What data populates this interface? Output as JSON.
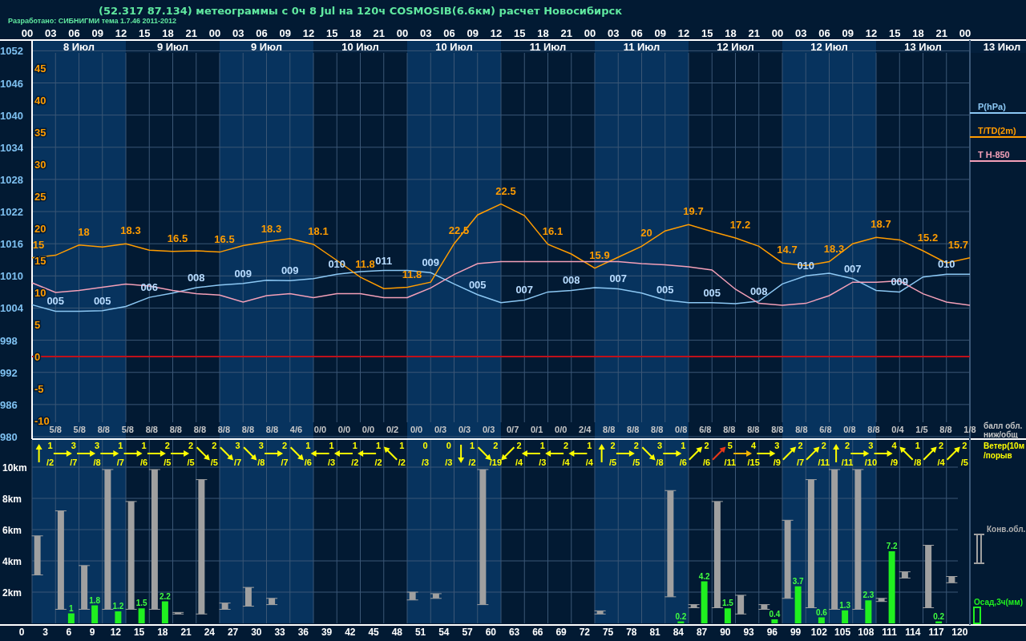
{
  "header": {
    "title": "(52.317 87.134) метеограммы с  0ч 8 Jul на 120ч COSMOSIB(6.6км) расчет Новосибирск",
    "credit": "Разработано: СИБНИГМИ тема 1.7.46 2011-2012"
  },
  "days": [
    {
      "label": "8 Июл",
      "shaded": true
    },
    {
      "label": "9 Июл",
      "shaded": false
    },
    {
      "label": "9 Июл",
      "shaded": true
    },
    {
      "label": "10 Июл",
      "shaded": false
    },
    {
      "label": "10 Июл",
      "shaded": true
    },
    {
      "label": "11 Июл",
      "shaded": false
    },
    {
      "label": "11 Июл",
      "shaded": true
    },
    {
      "label": "12 Июл",
      "shaded": false
    },
    {
      "label": "12 Июл",
      "shaded": true
    },
    {
      "label": "13 Июл",
      "shaded": false
    },
    {
      "label": "13 Июл",
      "shaded": false
    }
  ],
  "pressure_chart": {
    "chart_data": {
      "type": "line",
      "ylim": [
        980,
        1054
      ],
      "yticks": [
        1052,
        1046,
        1040,
        1034,
        1028,
        1022,
        1016,
        1010,
        1004,
        998,
        992,
        986,
        980
      ],
      "series": [
        {
          "name": "P(hPa)",
          "color": "#8cc8f4",
          "values": [
            1004.6,
            1003.4,
            1003.4,
            1003.5,
            1004.3,
            1006,
            1006.8,
            1007.8,
            1008.3,
            1008.6,
            1009.2,
            1009.1,
            1009.5,
            1010.3,
            1010.8,
            1011,
            1011,
            1010.6,
            1008.5,
            1006.5,
            1005,
            1005.5,
            1007,
            1007.3,
            1007.8,
            1007.6,
            1006.8,
            1005.5,
            1005,
            1005,
            1004.8,
            1005.3,
            1008.5,
            1010,
            1010.5,
            1009.5,
            1007.3,
            1007,
            1009.8,
            1010.3,
            1010.3
          ]
        }
      ]
    }
  },
  "temperature_chart": {
    "chart_data": {
      "type": "line",
      "categories": [
        "00",
        "03",
        "06",
        "09",
        "12",
        "15",
        "18",
        "21",
        "00",
        "03",
        "06",
        "09",
        "12",
        "15",
        "18",
        "21",
        "00",
        "03",
        "06",
        "09",
        "12",
        "15",
        "18",
        "21",
        "00",
        "03",
        "06",
        "09",
        "12",
        "15",
        "18",
        "21",
        "00",
        "03",
        "06",
        "09",
        "12",
        "15",
        "18",
        "21",
        "00"
      ],
      "ylim": [
        -10,
        45
      ],
      "yticks": [
        45,
        40,
        35,
        30,
        25,
        20,
        15,
        10,
        5,
        0,
        -5,
        -10
      ],
      "ref_lines": [
        {
          "axis": "y",
          "value": 0,
          "color": "#c0101a"
        }
      ],
      "series": [
        {
          "name": "T/TD(2m)",
          "color": "#ff9c00",
          "values": [
            15.4,
            15.8,
            17.4,
            17.1,
            17.6,
            16.6,
            16.4,
            16.5,
            16.3,
            17.3,
            17.9,
            18.4,
            17.5,
            15,
            12.4,
            10.6,
            10.8,
            11.6,
            17.6,
            22.1,
            23.8,
            22,
            17.5,
            16,
            13.8,
            15.5,
            17.2,
            19.6,
            20.6,
            19.5,
            18.5,
            17.2,
            14.6,
            14.2,
            14.8,
            17.6,
            18.6,
            18.2,
            16.5,
            14.6,
            15.4
          ]
        },
        {
          "name": "T H-850",
          "color": "#f4a0b8",
          "values": [
            11.5,
            10,
            10.3,
            10.8,
            11.3,
            11,
            10.3,
            9.8,
            9.6,
            8.5,
            9.5,
            9.8,
            9.2,
            9.8,
            9.8,
            9.2,
            9.2,
            10.7,
            12.8,
            14.5,
            14.8,
            14.8,
            14.8,
            14.8,
            14.8,
            14.8,
            14.5,
            14.3,
            14,
            13.5,
            10.5,
            8.3,
            8,
            8.3,
            9.5,
            11.6,
            11.6,
            11.8,
            9.8,
            8.5,
            8
          ]
        }
      ]
    }
  },
  "pressure_labels": [
    "005",
    "005",
    "006",
    "008",
    "009",
    "009",
    "010",
    "011",
    "009",
    "005",
    "007",
    "008",
    "007",
    "005",
    "005",
    "008",
    "010",
    "007",
    "009",
    "010"
  ],
  "temperature_labels": [
    "15",
    "18",
    "18.3",
    "16.5",
    "16.5",
    "18.3",
    "18.1",
    "11.8",
    "11.8",
    "22.5",
    "22.5",
    "16.1",
    "15.9",
    "20",
    "19.7",
    "17.2",
    "14.7",
    "18.3",
    "18.7",
    "15.2",
    "15.7"
  ],
  "cloud_cover": {
    "title": [
      "балл обл.",
      "ниж/общ"
    ],
    "values": [
      "5/8",
      "5/8",
      "8/8",
      "5/8",
      "8/8",
      "8/8",
      "8/8",
      "8/8",
      "8/8",
      "8/8",
      "4/6",
      "0/0",
      "0/0",
      "0/0",
      "0/2",
      "0/0",
      "0/3",
      "0/3",
      "0/3",
      "0/7",
      "0/1",
      "0/0",
      "2/4",
      "8/8",
      "8/8",
      "8/8",
      "0/8",
      "6/8",
      "8/8",
      "8/8",
      "8/8",
      "8/8",
      "6/8",
      "0/8",
      "8/8",
      "0/4",
      "1/5",
      "8/8",
      "1/8"
    ]
  },
  "wind": {
    "title": [
      "Ветер(10м",
      "/порыв"
    ],
    "items": [
      {
        "speed": "1",
        "gust": "/2",
        "kind": "north",
        "color": "#ffff00"
      },
      {
        "speed": "3",
        "gust": "/7",
        "kind": "east",
        "color": "#ffff00"
      },
      {
        "speed": "3",
        "gust": "/8",
        "kind": "east",
        "color": "#ffff00"
      },
      {
        "speed": "1",
        "gust": "/7",
        "kind": "east",
        "color": "#ffff00"
      },
      {
        "speed": "1",
        "gust": "/6",
        "kind": "east",
        "color": "#ffff00"
      },
      {
        "speed": "2",
        "gust": "/5",
        "kind": "east",
        "color": "#ffff00"
      },
      {
        "speed": "2",
        "gust": "/5",
        "kind": "east",
        "color": "#ffff00"
      },
      {
        "speed": "2",
        "gust": "/5",
        "kind": "southeast",
        "color": "#ffff00"
      },
      {
        "speed": "3",
        "gust": "/7",
        "kind": "southeast",
        "color": "#ffff00"
      },
      {
        "speed": "3",
        "gust": "/8",
        "kind": "southeast",
        "color": "#ffff00"
      },
      {
        "speed": "2",
        "gust": "/7",
        "kind": "east",
        "color": "#ffff00"
      },
      {
        "speed": "1",
        "gust": "/6",
        "kind": "southeast",
        "color": "#ffff00"
      },
      {
        "speed": "1",
        "gust": "/3",
        "kind": "west",
        "color": "#ffff00"
      },
      {
        "speed": "1",
        "gust": "/2",
        "kind": "west",
        "color": "#ffff00"
      },
      {
        "speed": "1",
        "gust": "/2",
        "kind": "west",
        "color": "#ffff00"
      },
      {
        "speed": "1",
        "gust": "/2",
        "kind": "northwest",
        "color": "#ffff00"
      },
      {
        "speed": "0",
        "gust": "/3",
        "kind": "calm"
      },
      {
        "speed": "0",
        "gust": "/3",
        "kind": "calm"
      },
      {
        "speed": "1",
        "gust": "/2",
        "kind": "south",
        "color": "#ffff00"
      },
      {
        "speed": "2",
        "gust": "/19",
        "kind": "southeast",
        "color": "#ffff00"
      },
      {
        "speed": "2",
        "gust": "/4",
        "kind": "southwest",
        "color": "#ffff00"
      },
      {
        "speed": "1",
        "gust": "/3",
        "kind": "west",
        "color": "#ffff00"
      },
      {
        "speed": "2",
        "gust": "/4",
        "kind": "west",
        "color": "#ffff00"
      },
      {
        "speed": "1",
        "gust": "/4",
        "kind": "west",
        "color": "#ffff00"
      },
      {
        "speed": "2",
        "gust": "/5",
        "kind": "north",
        "color": "#ffff00"
      },
      {
        "speed": "2",
        "gust": "/5",
        "kind": "east",
        "color": "#ffff00"
      },
      {
        "speed": "3",
        "gust": "/8",
        "kind": "southeast",
        "color": "#ffff00"
      },
      {
        "speed": "1",
        "gust": "/6",
        "kind": "east",
        "color": "#ffff00"
      },
      {
        "speed": "2",
        "gust": "/6",
        "kind": "northeast",
        "color": "#ffff00"
      },
      {
        "speed": "5",
        "gust": "/11",
        "kind": "northeast",
        "color": "#e83818"
      },
      {
        "speed": "4",
        "gust": "/15",
        "kind": "east",
        "color": "#f4b400"
      },
      {
        "speed": "3",
        "gust": "/9",
        "kind": "east",
        "color": "#ffff00"
      },
      {
        "speed": "2",
        "gust": "/7",
        "kind": "northeast",
        "color": "#ffff00"
      },
      {
        "speed": "2",
        "gust": "/11",
        "kind": "northeast",
        "color": "#ffff00"
      },
      {
        "speed": "2",
        "gust": "/11",
        "kind": "north",
        "color": "#ffff00"
      },
      {
        "speed": "3",
        "gust": "/10",
        "kind": "east",
        "color": "#ffff00"
      },
      {
        "speed": "4",
        "gust": "/9",
        "kind": "east",
        "color": "#ffff00"
      },
      {
        "speed": "1",
        "gust": "/8",
        "kind": "northwest",
        "color": "#ffff00"
      },
      {
        "speed": "2",
        "gust": "/4",
        "kind": "northeast",
        "color": "#ffff00"
      },
      {
        "speed": "2",
        "gust": "/5",
        "kind": "northeast",
        "color": "#ffff00"
      }
    ]
  },
  "lower": {
    "height_axis": [
      "10km",
      "8km",
      "6km",
      "4km",
      "2km"
    ],
    "origin_label": "0",
    "legend": [
      {
        "label": "Конв.обл.",
        "color": "#a0a0a0"
      },
      {
        "label": "Осад,3ч(мм)",
        "color": "#20f020"
      }
    ],
    "slots": [
      {
        "hour": "3"
      },
      {
        "hour": "6",
        "precip": "1"
      },
      {
        "hour": "9",
        "precip": "1.8"
      },
      {
        "hour": "12",
        "precip": "1.2"
      },
      {
        "hour": "15",
        "precip": "1.5"
      },
      {
        "hour": "18",
        "precip": "2.2"
      },
      {
        "hour": "21"
      },
      {
        "hour": "24"
      },
      {
        "hour": "27"
      },
      {
        "hour": "30"
      },
      {
        "hour": "33"
      },
      {
        "hour": "36"
      },
      {
        "hour": "39"
      },
      {
        "hour": "42"
      },
      {
        "hour": "45"
      },
      {
        "hour": "48"
      },
      {
        "hour": "51"
      },
      {
        "hour": "54"
      },
      {
        "hour": "57"
      },
      {
        "hour": "60"
      },
      {
        "hour": "63"
      },
      {
        "hour": "66"
      },
      {
        "hour": "69"
      },
      {
        "hour": "72"
      },
      {
        "hour": "75"
      },
      {
        "hour": "78"
      },
      {
        "hour": "81"
      },
      {
        "hour": "84",
        "precip": "0.2"
      },
      {
        "hour": "87",
        "precip": "4.2"
      },
      {
        "hour": "90",
        "precip": "1.5"
      },
      {
        "hour": "93"
      },
      {
        "hour": "96",
        "precip": "0.4"
      },
      {
        "hour": "99",
        "precip": "3.7"
      },
      {
        "hour": "102",
        "precip": "0.6"
      },
      {
        "hour": "105",
        "precip": "1.3"
      },
      {
        "hour": "108",
        "precip": "2.3"
      },
      {
        "hour": "111",
        "precip": "7.2"
      },
      {
        "hour": "114"
      },
      {
        "hour": "117",
        "precip": "0.2"
      },
      {
        "hour": "120"
      }
    ]
  }
}
